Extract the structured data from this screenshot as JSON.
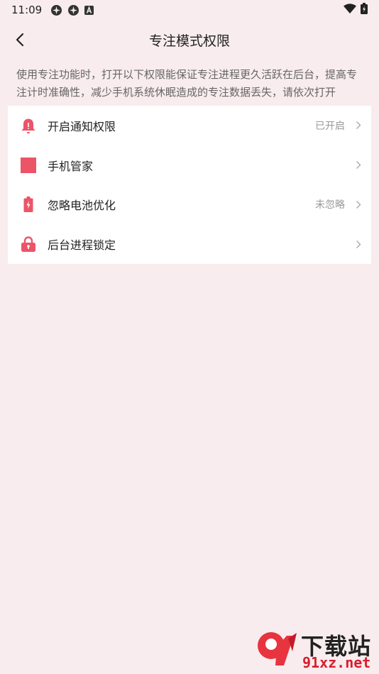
{
  "status_bar": {
    "time": "11:09",
    "icons": [
      "app-icon-1",
      "app-icon-2",
      "a-icon",
      "wifi-icon",
      "battery-icon"
    ]
  },
  "header": {
    "title": "专注模式权限",
    "back_icon": "chevron-left-icon"
  },
  "description": "使用专注功能时，打开以下权限能保证专注进程更久活跃在后台，提高专注计时准确性，减少手机系统休眠造成的专注数据丢失，请依次打开",
  "permissions": [
    {
      "label": "开启通知权限",
      "status": "已开启",
      "icon": "bell-icon"
    },
    {
      "label": "手机管家",
      "status": "",
      "icon": "square-icon"
    },
    {
      "label": "忽略电池优化",
      "status": "未忽略",
      "icon": "battery-icon"
    },
    {
      "label": "后台进程锁定",
      "status": "",
      "icon": "lock-icon"
    }
  ],
  "colors": {
    "background": "#f8ecee",
    "accent": "#ec5468",
    "card": "#ffffff"
  },
  "watermark": {
    "logo_text": "9",
    "title": "下载站",
    "domain": "91xz.net"
  }
}
